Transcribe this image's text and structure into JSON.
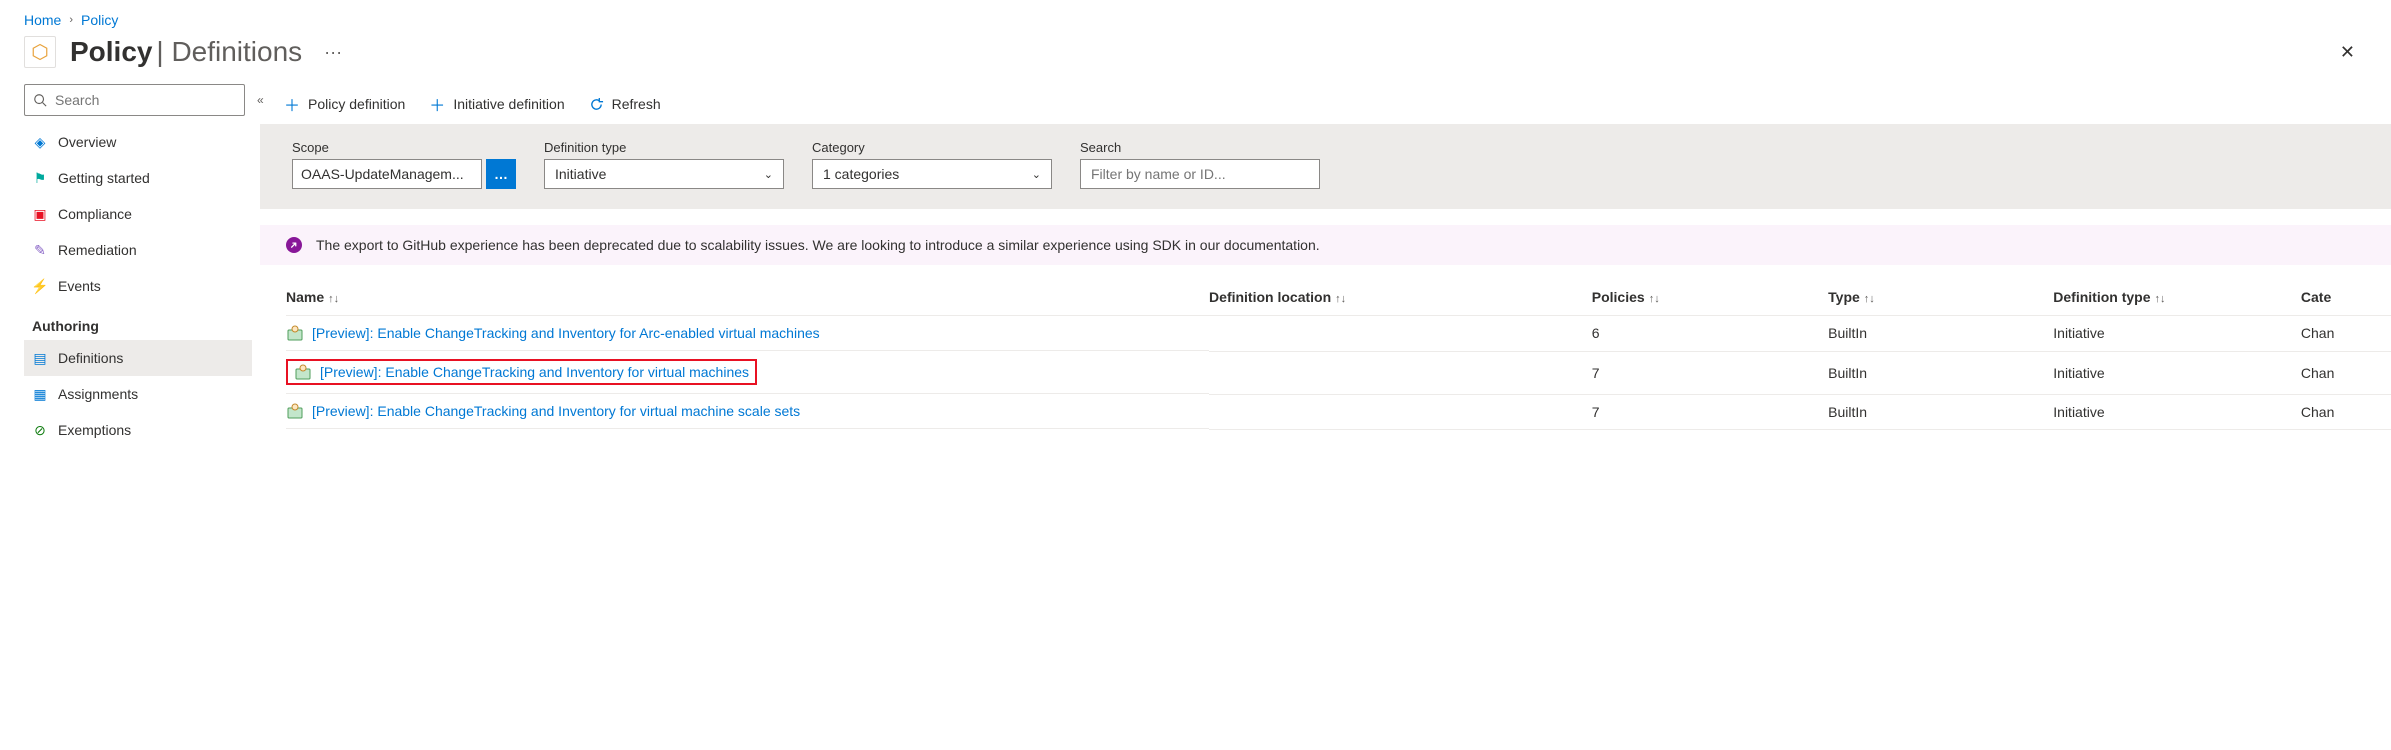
{
  "breadcrumb": {
    "home": "Home",
    "current": "Policy"
  },
  "header": {
    "service": "Policy",
    "page": "Definitions"
  },
  "sidebar": {
    "search_placeholder": "Search",
    "items": {
      "overview": "Overview",
      "getting_started": "Getting started",
      "compliance": "Compliance",
      "remediation": "Remediation",
      "events": "Events"
    },
    "authoring_label": "Authoring",
    "authoring": {
      "definitions": "Definitions",
      "assignments": "Assignments",
      "exemptions": "Exemptions"
    }
  },
  "toolbar": {
    "policy_def": "Policy definition",
    "initiative_def": "Initiative definition",
    "refresh": "Refresh"
  },
  "filters": {
    "scope_label": "Scope",
    "scope_value": "OAAS-UpdateManagem...",
    "deftype_label": "Definition type",
    "deftype_value": "Initiative",
    "category_label": "Category",
    "category_value": "1 categories",
    "search_label": "Search",
    "search_placeholder": "Filter by name or ID..."
  },
  "notice": "The export to GitHub experience has been deprecated due to scalability issues. We are looking to introduce a similar experience using SDK in our documentation.",
  "columns": {
    "name": "Name",
    "location": "Definition location",
    "policies": "Policies",
    "type": "Type",
    "definition_type": "Definition type",
    "category": "Cate"
  },
  "rows": [
    {
      "name": "[Preview]: Enable ChangeTracking and Inventory for Arc-enabled virtual machines",
      "location": "",
      "policies": "6",
      "type": "BuiltIn",
      "deftype": "Initiative",
      "category": "Chan"
    },
    {
      "name": "[Preview]: Enable ChangeTracking and Inventory for virtual machines",
      "location": "",
      "policies": "7",
      "type": "BuiltIn",
      "deftype": "Initiative",
      "category": "Chan"
    },
    {
      "name": "[Preview]: Enable ChangeTracking and Inventory for virtual machine scale sets",
      "location": "",
      "policies": "7",
      "type": "BuiltIn",
      "deftype": "Initiative",
      "category": "Chan"
    }
  ]
}
